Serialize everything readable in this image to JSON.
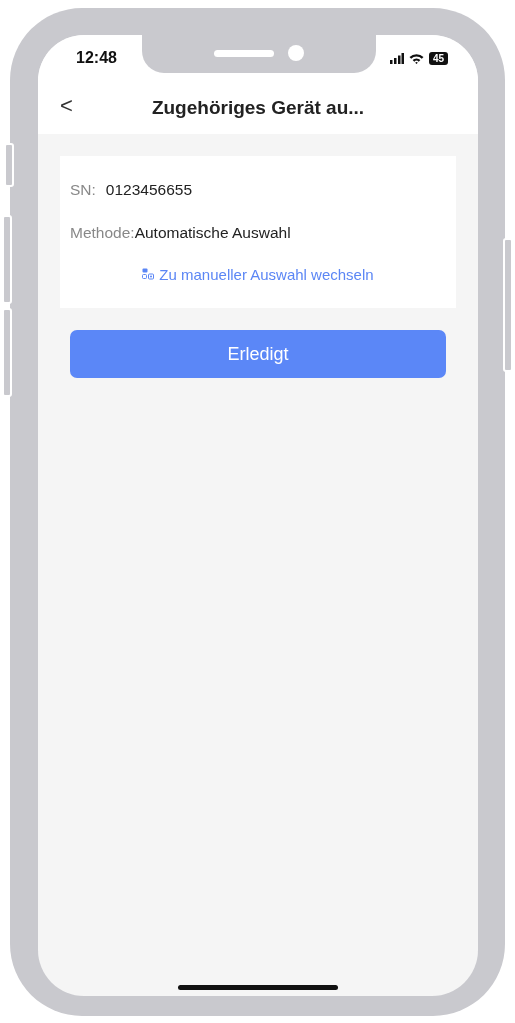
{
  "status_bar": {
    "time": "12:48",
    "battery": "45"
  },
  "header": {
    "back": "<",
    "title": "Zugehöriges Gerät au..."
  },
  "device": {
    "sn_label": "SN:",
    "sn_value": "0123456655",
    "method_label": "Methode:",
    "method_value": "Automatische Auswahl",
    "switch_link": "Zu manueller Auswahl wechseln"
  },
  "buttons": [
    "Erledigt"
  ]
}
